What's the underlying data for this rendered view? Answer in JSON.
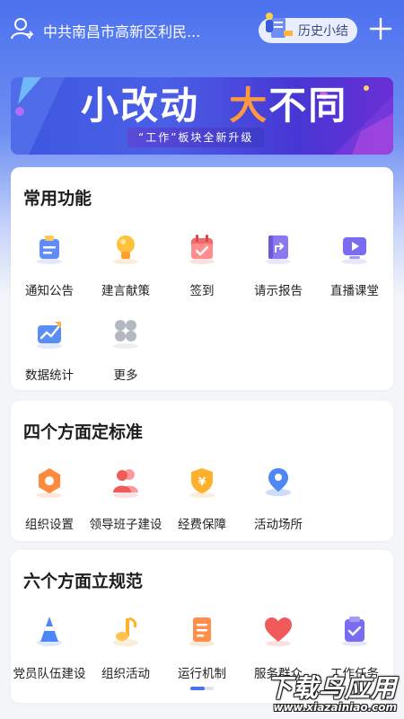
{
  "header": {
    "org_name": "中共南昌市高新区利民...",
    "history_label": "历史小结"
  },
  "banner": {
    "title_part1": "小改动",
    "title_part2": "大",
    "title_part3": "不同",
    "subtitle": "“工作”板块全新升级"
  },
  "sections": [
    {
      "title": "常用功能",
      "items": [
        {
          "label": "通知公告",
          "icon": "notice-icon"
        },
        {
          "label": "建言献策",
          "icon": "lightbulb-icon"
        },
        {
          "label": "签到",
          "icon": "calendar-icon"
        },
        {
          "label": "请示报告",
          "icon": "report-icon"
        },
        {
          "label": "直播课堂",
          "icon": "live-play-icon"
        },
        {
          "label": "数据统计",
          "icon": "chart-icon"
        },
        {
          "label": "更多",
          "icon": "more-icon"
        }
      ]
    },
    {
      "title": "四个方面定标准",
      "items": [
        {
          "label": "组织设置",
          "icon": "hexagon-icon"
        },
        {
          "label": "领导班子建设",
          "icon": "people-icon"
        },
        {
          "label": "经费保障",
          "icon": "yuan-shield-icon"
        },
        {
          "label": "活动场所",
          "icon": "location-icon"
        }
      ]
    },
    {
      "title": "六个方面立规范",
      "items": [
        {
          "label": "党员队伍建设",
          "icon": "cone-icon"
        },
        {
          "label": "组织活动",
          "icon": "music-note-icon"
        },
        {
          "label": "运行机制",
          "icon": "document-icon"
        },
        {
          "label": "服务群众",
          "icon": "heart-icon"
        },
        {
          "label": "工作任务",
          "icon": "task-check-icon"
        }
      ]
    }
  ],
  "watermark": {
    "main": "下载鸟应用",
    "url": "www.xiazainiao.com"
  },
  "colors": {
    "primary": "#4b71ee",
    "accent_orange": "#ff9a3c"
  }
}
